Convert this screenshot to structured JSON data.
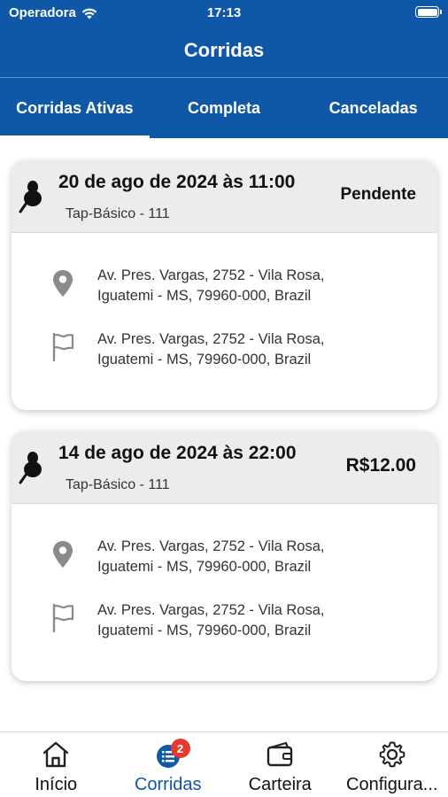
{
  "status_bar": {
    "carrier": "Operadora",
    "time": "17:13"
  },
  "header": {
    "title": "Corridas"
  },
  "tabs": [
    {
      "label": "Corridas Ativas",
      "active": true
    },
    {
      "label": "Completa",
      "active": false
    },
    {
      "label": "Canceladas",
      "active": false
    }
  ],
  "rides": [
    {
      "date": "20 de ago de 2024 às 11:00",
      "service": "Tap-Básico - 111",
      "status": "Pendente",
      "pickup": {
        "line1": "Av. Pres. Vargas, 2752 - Vila Rosa,",
        "line2": "Iguatemi - MS, 79960-000, Brazil"
      },
      "destination": {
        "line1": "Av. Pres. Vargas, 2752 - Vila Rosa,",
        "line2": "Iguatemi - MS, 79960-000, Brazil"
      }
    },
    {
      "date": "14 de ago de 2024 às 22:00",
      "service": "Tap-Básico - 111",
      "price": "R$12.00",
      "pickup": {
        "line1": "Av. Pres. Vargas, 2752 - Vila Rosa,",
        "line2": "Iguatemi - MS, 79960-000, Brazil"
      },
      "destination": {
        "line1": "Av. Pres. Vargas, 2752 - Vila Rosa,",
        "line2": "Iguatemi - MS, 79960-000, Brazil"
      }
    }
  ],
  "bottom_nav": [
    {
      "label": "Início",
      "icon": "home-icon",
      "active": false
    },
    {
      "label": "Corridas",
      "icon": "rides-list-icon",
      "active": true,
      "badge": "2"
    },
    {
      "label": "Carteira",
      "icon": "wallet-icon",
      "active": false
    },
    {
      "label": "Configura...",
      "icon": "gear-icon",
      "active": false
    }
  ],
  "colors": {
    "primary": "#0f57a7",
    "badge": "#e53935",
    "card_header": "#ececec"
  }
}
